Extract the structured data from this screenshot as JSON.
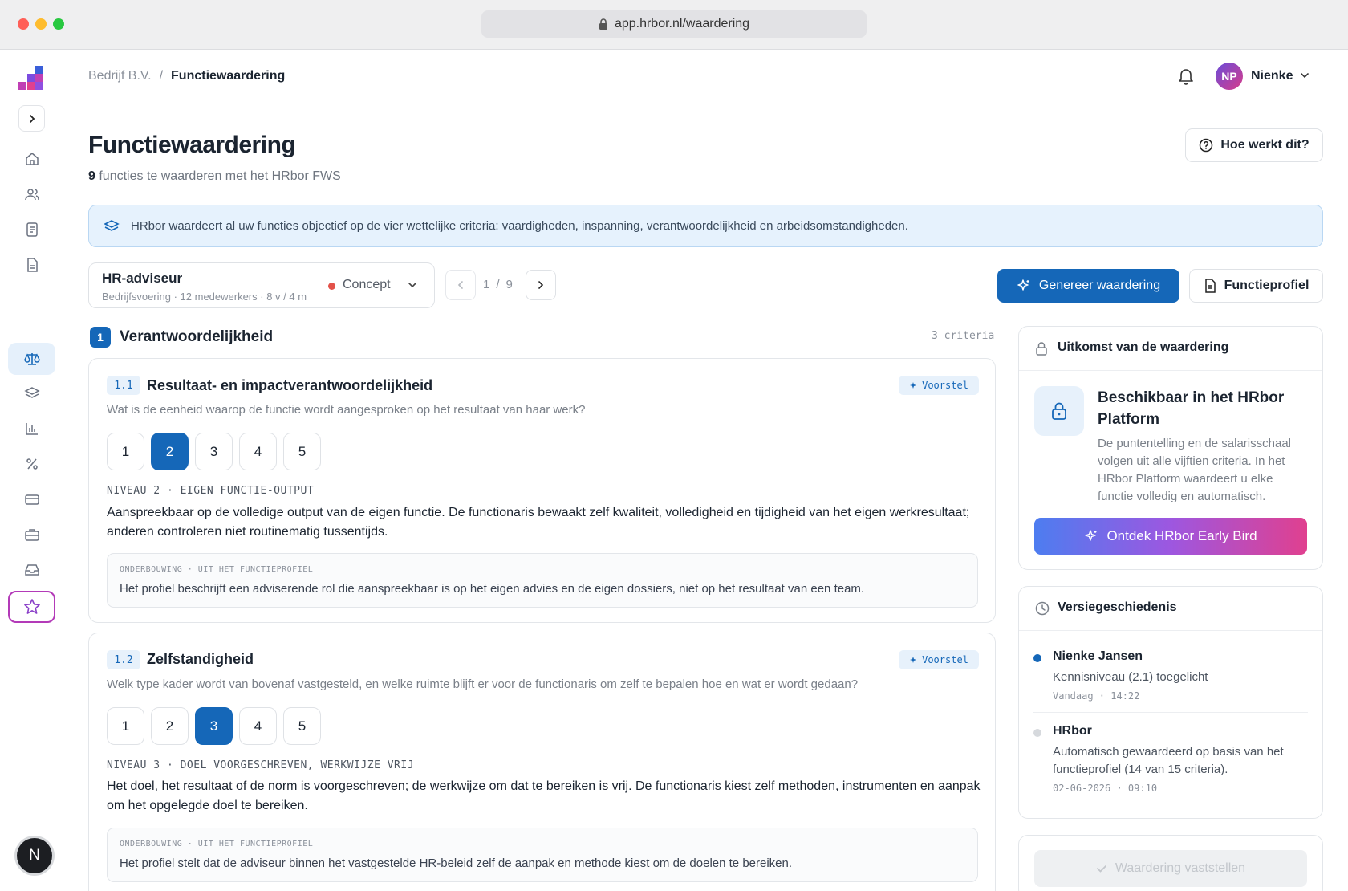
{
  "browser": {
    "url": "app.hrbor.nl/waardering",
    "dot_colors": [
      "#ff5f57",
      "#febc2e",
      "#28c840"
    ]
  },
  "sidebar": {
    "items": [
      {
        "icon": "home-icon"
      },
      {
        "icon": "users-icon"
      },
      {
        "icon": "list-icon"
      },
      {
        "icon": "document-icon"
      },
      {
        "icon": "scale-icon",
        "active": true
      },
      {
        "icon": "layers-icon"
      },
      {
        "icon": "bar-chart-icon"
      },
      {
        "icon": "percent-icon"
      },
      {
        "icon": "credit-card-icon"
      },
      {
        "icon": "briefcase-icon"
      },
      {
        "icon": "inbox-icon"
      },
      {
        "icon": "star-icon",
        "featured": true
      }
    ],
    "user_initial": "N"
  },
  "topbar": {
    "breadcrumb_parent": "Bedrijf B.V.",
    "breadcrumb_separator": "/",
    "breadcrumb_current": "Functiewaardering",
    "user_initials": "NP",
    "user_name": "Nienke"
  },
  "header": {
    "title": "Functiewaardering",
    "subtitle_count": "9",
    "subtitle_text": "functies te waarderen met het HRbor FWS",
    "help_label": "Hoe werkt dit?"
  },
  "banner": {
    "text": "HRbor waardeert al uw functies objectief op de vier wettelijke criteria: vaardigheden, inspanning, verantwoordelijkheid en arbeidsomstandigheden."
  },
  "function": {
    "name": "HR-adviseur",
    "meta": "Bedrijfsvoering · 12 medewerkers · 8 v / 4 m",
    "status": "Concept",
    "status_color": "#e3524a",
    "pager_current": "1",
    "pager_sep": "/",
    "pager_total": "9"
  },
  "actions": {
    "generate_label": "Genereer waardering",
    "profile_label": "Functieprofiel"
  },
  "section": {
    "number": "1",
    "title": "Verantwoordelijkheid",
    "count": "3 criteria"
  },
  "criteria": [
    {
      "number": "1.1",
      "title": "Resultaat- en impactverantwoordelijkheid",
      "badge": "Voorstel",
      "question": "Wat is de eenheid waarop de functie wordt aangesproken op het resultaat van haar werk?",
      "levels": [
        "1",
        "2",
        "3",
        "4",
        "5"
      ],
      "selected": "2",
      "level_label": "NIVEAU 2 · EIGEN FUNCTIE-OUTPUT",
      "description": "Aanspreekbaar op de volledige output van de eigen functie. De functionaris bewaakt zelf kwaliteit, volledigheid en tijdigheid van het eigen werkresultaat; anderen controleren niet routinematig tussentijds.",
      "basis_label": "ONDERBOUWING · UIT HET FUNCTIEPROFIEL",
      "basis_text": "Het profiel beschrijft een adviserende rol die aanspreekbaar is op het eigen advies en de eigen dossiers, niet op het resultaat van een team."
    },
    {
      "number": "1.2",
      "title": "Zelfstandigheid",
      "badge": "Voorstel",
      "question": "Welk type kader wordt van bovenaf vastgesteld, en welke ruimte blijft er voor de functionaris om zelf te bepalen hoe en wat er wordt gedaan?",
      "levels": [
        "1",
        "2",
        "3",
        "4",
        "5"
      ],
      "selected": "3",
      "level_label": "NIVEAU 3 · DOEL VOORGESCHREVEN, WERKWIJZE VRIJ",
      "description": "Het doel, het resultaat of de norm is voorgeschreven; de werkwijze om dat te bereiken is vrij. De functionaris kiest zelf methoden, instrumenten en aanpak om het opgelegde doel te bereiken.",
      "basis_label": "ONDERBOUWING · UIT HET FUNCTIEPROFIEL",
      "basis_text": "Het profiel stelt dat de adviseur binnen het vastgestelde HR-beleid zelf de aanpak en methode kiest om de doelen te bereiken."
    }
  ],
  "outcome": {
    "title": "Uitkomst van de waardering",
    "available_title": "Beschikbaar in het HRbor Platform",
    "available_desc": "De puntentelling en de salarisschaal volgen uit alle vijftien criteria. In het HRbor Platform waardeert u elke functie volledig en automatisch.",
    "cta_label": "Ontdek HRbor Early Bird"
  },
  "history": {
    "title": "Versiegeschiedenis",
    "items": [
      {
        "name": "Nienke Jansen",
        "desc": "Kennisniveau (2.1) toegelicht",
        "time": "Vandaag · 14:22",
        "dot_color": "#1567b8"
      },
      {
        "name": "HRbor",
        "desc": "Automatisch gewaardeerd op basis van het functieprofiel (14 van 15 criteria).",
        "time": "02-06-2026 · 09:10",
        "dot_color": "#d6d9dd"
      }
    ]
  },
  "finalize": {
    "label": "Waardering vaststellen"
  },
  "colors": {
    "primary": "#1567b8",
    "accent_gradient_start": "#4d7df0",
    "accent_gradient_end": "#e0408f",
    "featured_border": "#b33ab8"
  }
}
